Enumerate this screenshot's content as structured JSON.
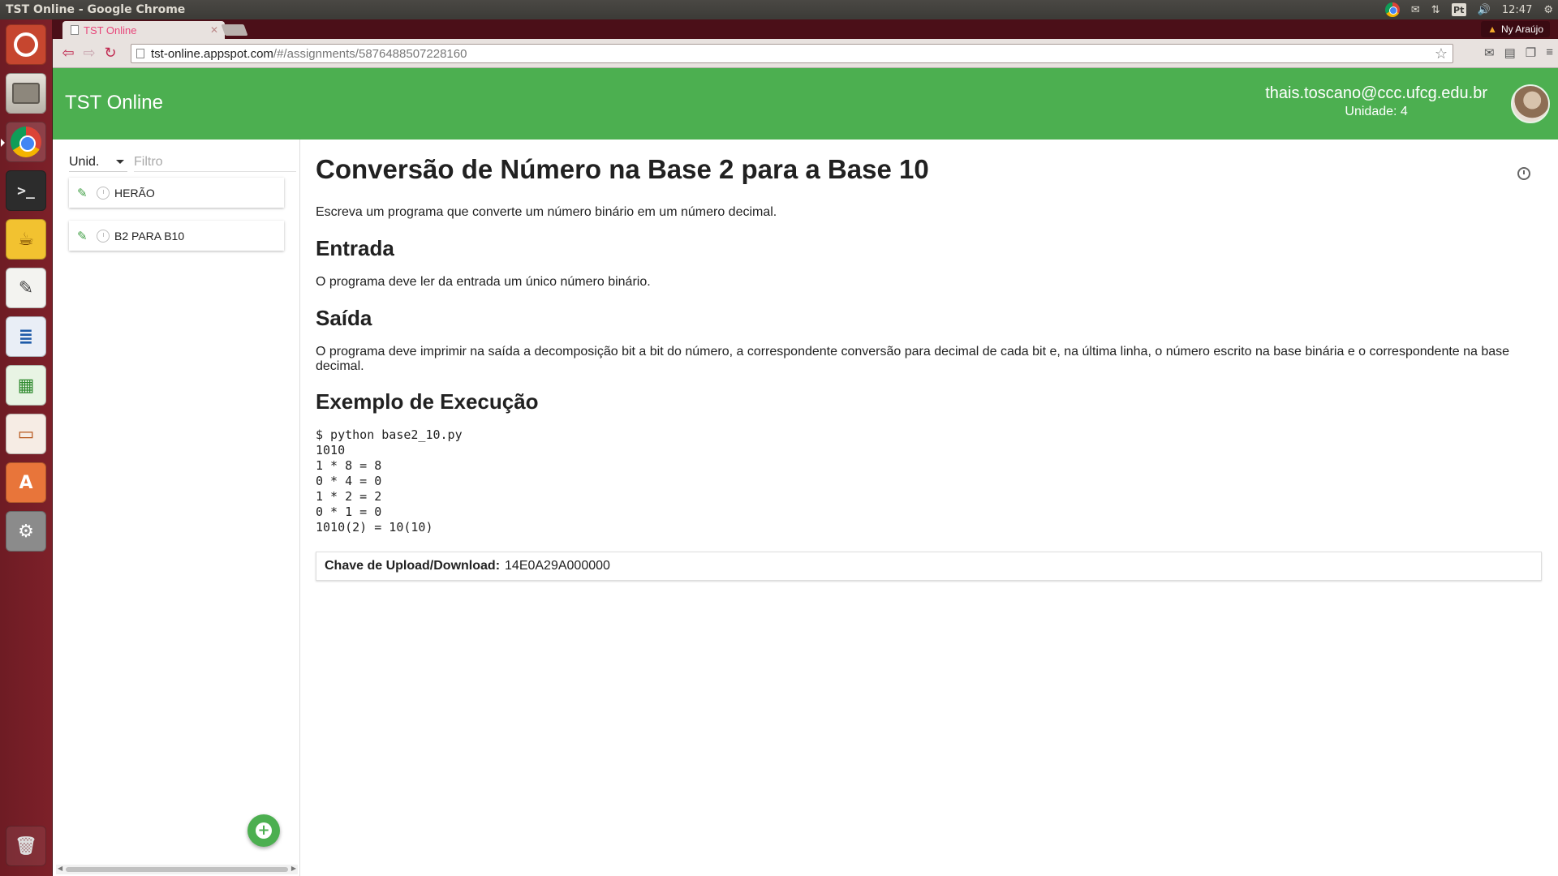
{
  "system": {
    "window_title": "TST Online - Google Chrome",
    "time": "12:47",
    "keyboard_layout": "Pt"
  },
  "launcher": {
    "items": [
      {
        "name": "ubuntu-dash-icon",
        "glyph": ""
      },
      {
        "name": "files-icon",
        "glyph": ""
      },
      {
        "name": "chrome-icon",
        "glyph": ""
      },
      {
        "name": "terminal-icon",
        "glyph": ">_"
      },
      {
        "name": "teapot-icon",
        "glyph": "☕"
      },
      {
        "name": "text-editor-icon",
        "glyph": "✎"
      },
      {
        "name": "writer-icon",
        "glyph": "≣"
      },
      {
        "name": "calc-icon",
        "glyph": "▦"
      },
      {
        "name": "impress-icon",
        "glyph": "▭"
      },
      {
        "name": "software-center-icon",
        "glyph": "A"
      },
      {
        "name": "settings-icon",
        "glyph": "⚙"
      },
      {
        "name": "trash-icon",
        "glyph": "🗑"
      }
    ]
  },
  "browser": {
    "tab_title": "TST Online",
    "profile_name": "Ny Araújo",
    "url_host": "tst-online.appspot.com",
    "url_path": "/#/assignments/5876488507228160"
  },
  "header": {
    "app_title": "TST Online",
    "user_email": "thais.toscano@ccc.ufcg.edu.br",
    "unit_label": "Unidade: 4",
    "color": "#4caf50"
  },
  "sidebar": {
    "unit_select_value": "Unid.",
    "filter_placeholder": "Filtro",
    "tasks": [
      {
        "label": "HERÃO"
      },
      {
        "label": "B2 PARA B10"
      }
    ]
  },
  "assignment": {
    "title": "Conversão de Número na Base 2 para a Base 10",
    "description": "Escreva um programa que converte um número binário em um número decimal.",
    "input_heading": "Entrada",
    "input_text": "O programa deve ler da entrada um único número binário.",
    "output_heading": "Saída",
    "output_text": "O programa deve imprimir na saída a decomposição bit a bit do número, a correspondente conversão para decimal de cada bit e, na última linha, o número escrito na base binária e o correspondente na base decimal.",
    "example_heading": "Exemplo de Execução",
    "example_code": "$ python base2_10.py\n1010\n1 * 8 = 8\n0 * 4 = 0\n1 * 2 = 2\n0 * 1 = 0\n1010(2) = 10(10)",
    "upload_key_label": "Chave de Upload/Download:",
    "upload_key_value": "14E0A29A000000"
  }
}
